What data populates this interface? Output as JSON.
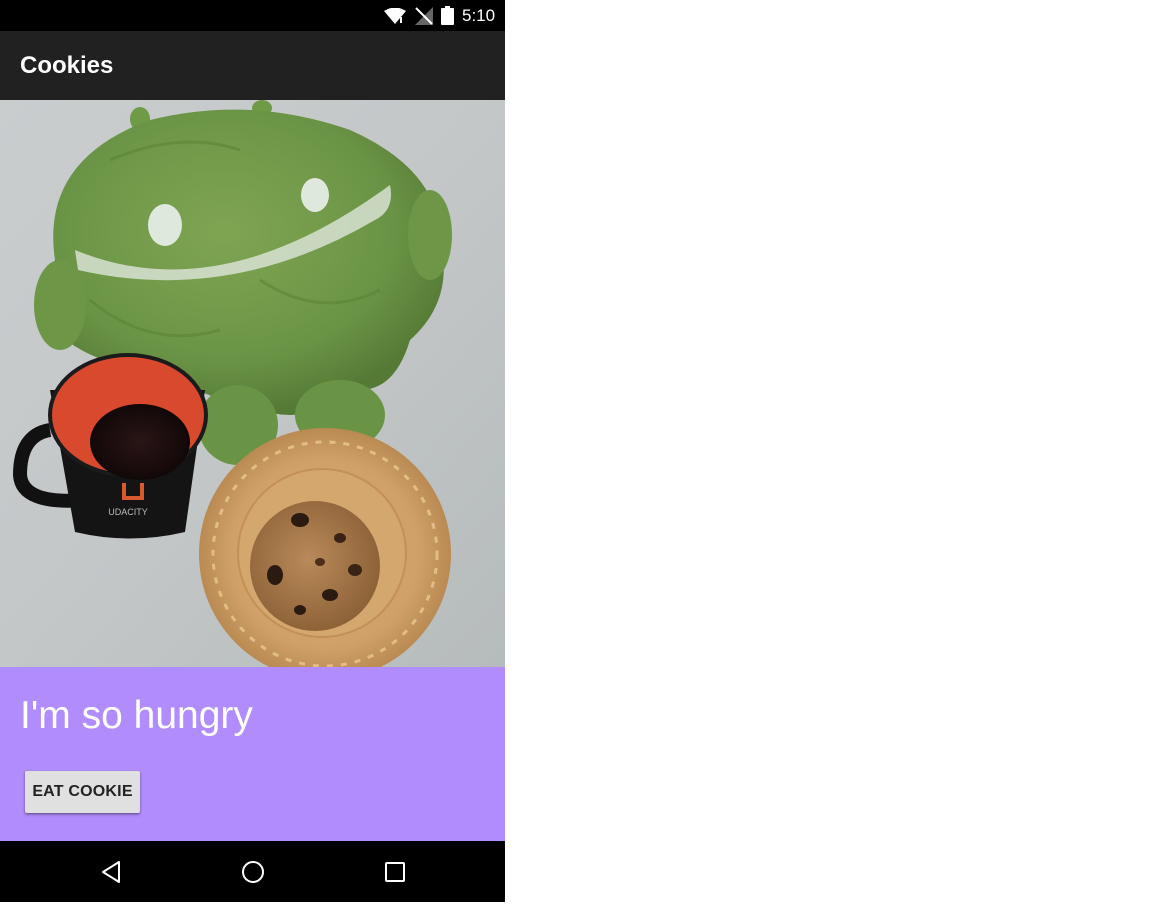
{
  "status_bar": {
    "time": "5:10",
    "icons": [
      "wifi-icon",
      "no-signal-icon",
      "battery-icon"
    ]
  },
  "action_bar": {
    "title": "Cookies"
  },
  "photo": {
    "subject": "plush-android-mug-and-cookie",
    "mug_text": "UDACITY"
  },
  "content": {
    "message": "I'm so hungry",
    "button_label": "EAT COOKIE"
  },
  "nav_bar": {
    "buttons": [
      "back-icon",
      "home-icon",
      "recents-icon"
    ]
  },
  "colors": {
    "status_bar": "#000000",
    "action_bar": "#212121",
    "content_background": "#b18cfc",
    "button_background": "#e0e0e0",
    "nav_bar": "#000000"
  }
}
